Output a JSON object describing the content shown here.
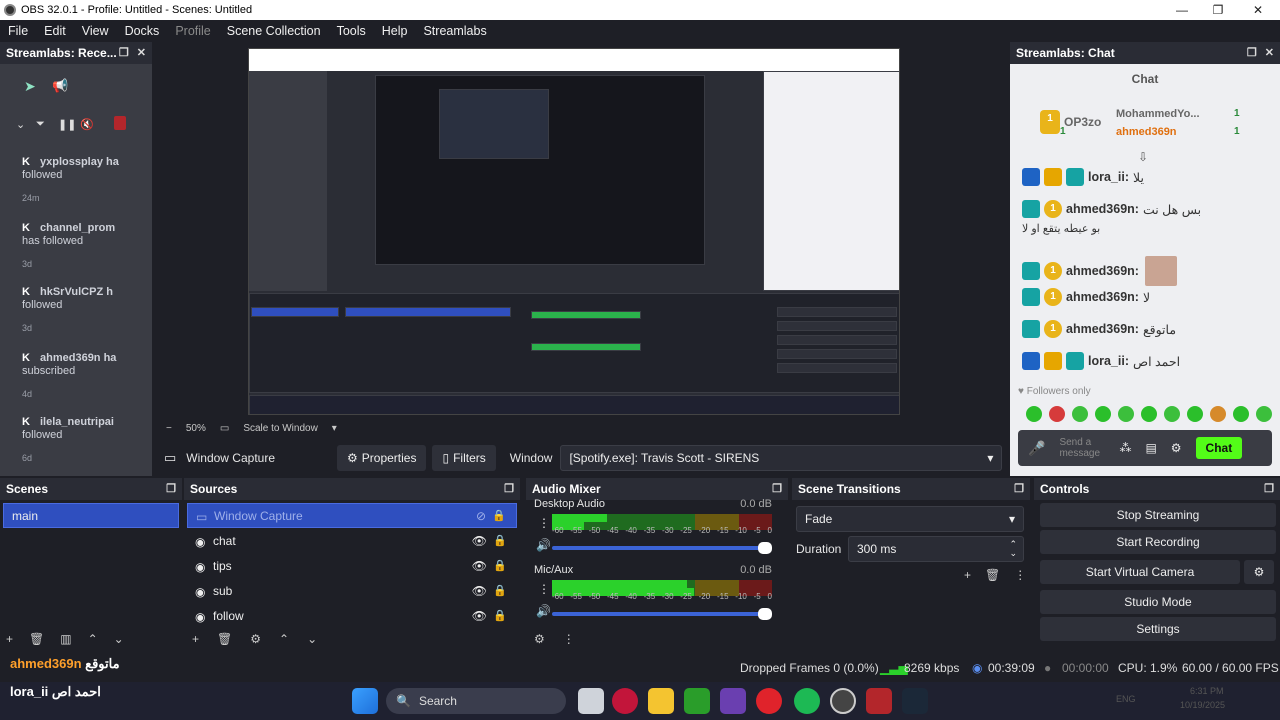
{
  "window": {
    "title": "OBS 32.0.1 - Profile: Untitled - Scenes: Untitled",
    "min": "—",
    "max": "❐",
    "close": "✕"
  },
  "menu": [
    "File",
    "Edit",
    "View",
    "Docks",
    "Profile",
    "Scene Collection",
    "Tools",
    "Help",
    "Streamlabs"
  ],
  "recent_dock": {
    "title": "Streamlabs: Rece...",
    "events": [
      {
        "user": "yxplossplay ha",
        "action": "followed",
        "time": "24m"
      },
      {
        "user": "channel_prom",
        "action": "has followed",
        "time": "3d"
      },
      {
        "user": "hkSrVulCPZ h",
        "action": "followed",
        "time": "3d"
      },
      {
        "user": "ahmed369n ha",
        "action": "subscribed",
        "time": "4d"
      },
      {
        "user": "ilela_neutripai",
        "action": "followed",
        "time": "6d"
      }
    ]
  },
  "chat_dock": {
    "title": "Streamlabs: Chat",
    "header": "Chat",
    "top_users": [
      {
        "name": "OP3zo",
        "count": "1"
      },
      {
        "name": "MohammedYo...",
        "count": "1"
      },
      {
        "name": "ahmed369n",
        "count": "1"
      }
    ],
    "messages": [
      {
        "user": "lora_ii:",
        "text": "يلا"
      },
      {
        "user": "ahmed369n:",
        "text": "بس هل نت"
      },
      {
        "user": "",
        "text": "بو عيطه يتقع او لا"
      },
      {
        "user": "ahmed369n:",
        "text": ""
      },
      {
        "user": "ahmed369n:",
        "text": "لا"
      },
      {
        "user": "ahmed369n:",
        "text": "ماتوقع"
      },
      {
        "user": "lora_ii:",
        "text": "احمد اص"
      }
    ],
    "followers_only": "Followers only",
    "send_placeholder": "Send a message",
    "chat_button": "Chat"
  },
  "preview": {
    "zoom": "50%",
    "scale": "Scale to Window"
  },
  "source_bar": {
    "source": "Window Capture",
    "properties": "Properties",
    "filters": "Filters",
    "window_label": "Window",
    "window_value": "[Spotify.exe]: Travis Scott - SIRENS"
  },
  "scenes": {
    "title": "Scenes",
    "items": [
      "main"
    ]
  },
  "sources": {
    "title": "Sources",
    "items": [
      "Window Capture",
      "chat",
      "tips",
      "sub",
      "follow"
    ]
  },
  "audio": {
    "title": "Audio Mixer",
    "channels": [
      {
        "name": "Desktop Audio",
        "db": "0.0 dB"
      },
      {
        "name": "Mic/Aux",
        "db": "0.0 dB"
      }
    ],
    "ticks": [
      "-60",
      "-55",
      "-50",
      "-45",
      "-40",
      "-35",
      "-30",
      "-25",
      "-20",
      "-15",
      "-10",
      "-5",
      "0"
    ]
  },
  "transitions": {
    "title": "Scene Transitions",
    "type": "Fade",
    "duration_label": "Duration",
    "duration": "300 ms"
  },
  "controls": {
    "title": "Controls",
    "buttons": [
      "Stop Streaming",
      "Start Recording",
      "Start Virtual Camera",
      "Studio Mode",
      "Settings"
    ]
  },
  "status": {
    "dropped": "Dropped Frames 0 (0.0%)",
    "kbps": "8269 kbps",
    "stream_time": "00:39:09",
    "rec_time": "00:00:00",
    "cpu": "CPU: 1.9%",
    "fps": "60.00 / 60.00 FPS"
  },
  "overlay": {
    "line1_user": "ahmed369n",
    "line1_text": "ماتوقع",
    "line2_user": "lora_ii",
    "line2_text": "احمد اص"
  },
  "taskbar": {
    "search": "Search",
    "time": "6:31 PM",
    "date": "10/19/2025",
    "lang": "ENG"
  }
}
